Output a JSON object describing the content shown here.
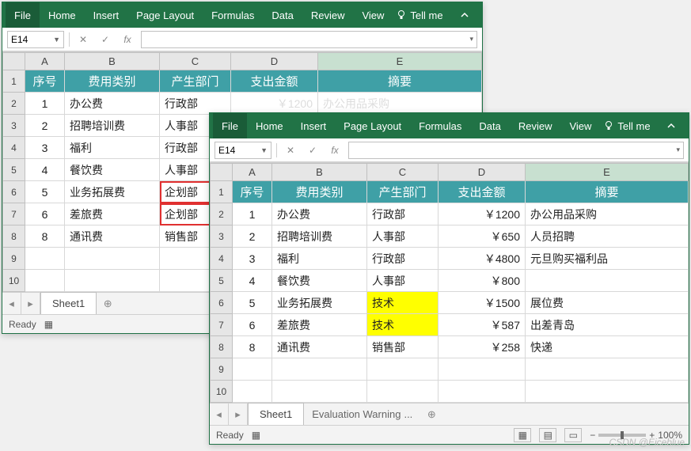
{
  "ribbon": {
    "file": "File",
    "home": "Home",
    "insert": "Insert",
    "pageLayout": "Page Layout",
    "formulas": "Formulas",
    "data": "Data",
    "review": "Review",
    "view": "View",
    "tellMe": "Tell me"
  },
  "fbar": {
    "name": "E14",
    "fx": "fx"
  },
  "headers": {
    "A": "A",
    "B": "B",
    "C": "C",
    "D": "D",
    "E": "E"
  },
  "colTitles": {
    "seq": "序号",
    "cat": "费用类别",
    "dept": "产生部门",
    "amount": "支出金额",
    "summary": "摘要"
  },
  "w1": {
    "rows": [
      {
        "seq": "1",
        "cat": "办公费",
        "dept": "行政部"
      },
      {
        "seq": "2",
        "cat": "招聘培训费",
        "dept": "人事部"
      },
      {
        "seq": "3",
        "cat": "福利",
        "dept": "行政部"
      },
      {
        "seq": "4",
        "cat": "餐饮费",
        "dept": "人事部"
      },
      {
        "seq": "5",
        "cat": "业务拓展费",
        "dept": "企划部"
      },
      {
        "seq": "6",
        "cat": "差旅费",
        "dept": "企划部"
      },
      {
        "seq": "8",
        "cat": "通讯费",
        "dept": "销售部"
      }
    ],
    "partialAmount": "￥1200",
    "partialSummary": "办公用品采购"
  },
  "w2": {
    "rows": [
      {
        "seq": "1",
        "cat": "办公费",
        "dept": "行政部",
        "amount": "￥1200",
        "summary": "办公用品采购"
      },
      {
        "seq": "2",
        "cat": "招聘培训费",
        "dept": "人事部",
        "amount": "￥650",
        "summary": "人员招聘"
      },
      {
        "seq": "3",
        "cat": "福利",
        "dept": "行政部",
        "amount": "￥4800",
        "summary": "元旦购买福利品"
      },
      {
        "seq": "4",
        "cat": "餐饮费",
        "dept": "人事部",
        "amount": "￥800",
        "summary": ""
      },
      {
        "seq": "5",
        "cat": "业务拓展费",
        "dept": "技术",
        "amount": "￥1500",
        "summary": "展位费"
      },
      {
        "seq": "6",
        "cat": "差旅费",
        "dept": "技术",
        "amount": "￥587",
        "summary": "出差青岛"
      },
      {
        "seq": "8",
        "cat": "通讯费",
        "dept": "销售部",
        "amount": "￥258",
        "summary": "快递"
      }
    ]
  },
  "tabs": {
    "sheet": "Sheet1",
    "eval": "Evaluation Warning",
    "dots": "..."
  },
  "status": {
    "ready": "Ready",
    "zoom": "100%"
  },
  "watermark": "CSDN @Eiceblue"
}
